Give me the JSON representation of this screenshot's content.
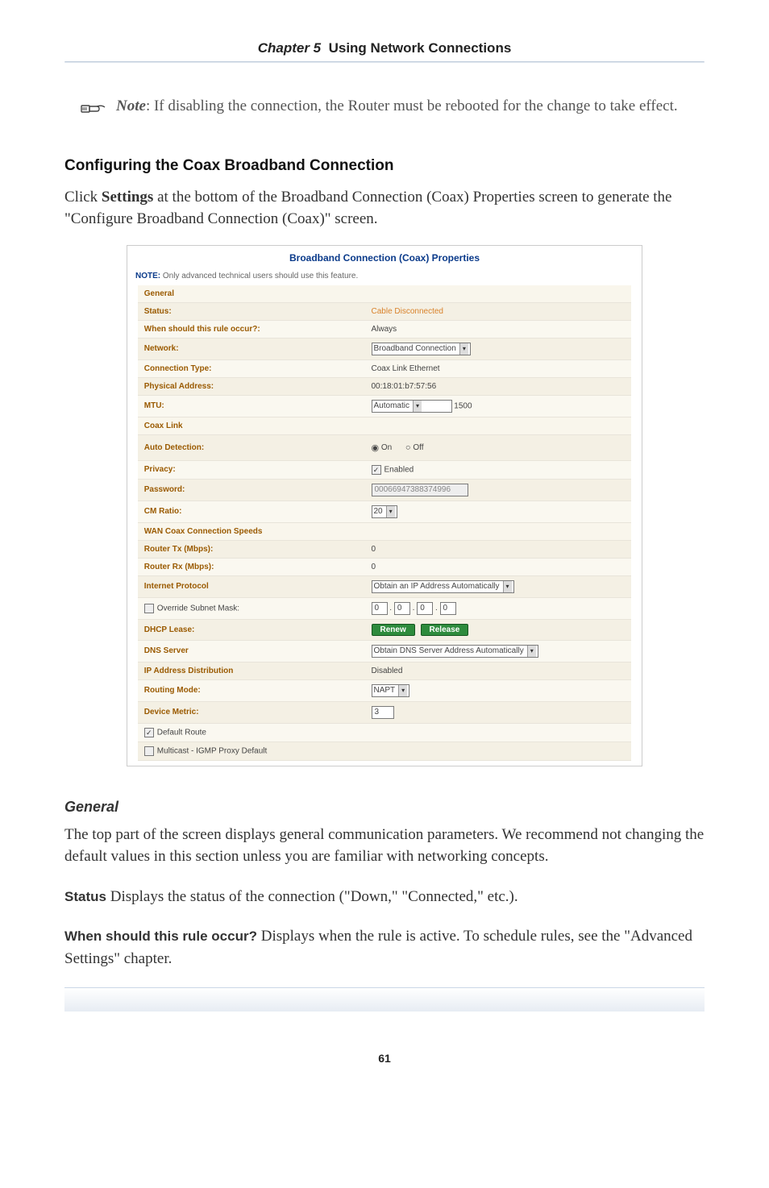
{
  "header": {
    "chapter_label": "Chapter 5",
    "chapter_title": "Using Network Connections"
  },
  "note": {
    "prefix": "Note",
    "text": ": If disabling the connection, the Router must be rebooted for the change to take effect."
  },
  "section1": {
    "heading": "Configuring the Coax Broadband Connection",
    "para": "Click Settings at the bottom of the Broadband Connection (Coax) Properties screen to generate the \"Configure Broadband Connection (Coax)\" screen.",
    "para_pre": "Click ",
    "para_bold": "Settings",
    "para_post": " at the bottom of the Broadband Connection (Coax) Properties screen to generate the \"Configure Broadband Connection (Coax)\" screen."
  },
  "screenshot": {
    "title": "Broadband Connection (Coax) Properties",
    "note_prefix": "NOTE:",
    "note_text": " Only advanced technical users should use this feature.",
    "sections": {
      "general": "General",
      "coax_link": "Coax Link",
      "wan_speeds": "WAN Coax Connection Speeds"
    },
    "rows": {
      "status_label": "Status:",
      "status_value": "Cable Disconnected",
      "rule_label": "When should this rule occur?:",
      "rule_value": "Always",
      "network_label": "Network:",
      "network_value": "Broadband Connection",
      "conn_type_label": "Connection Type:",
      "conn_type_value": "Coax Link Ethernet",
      "phys_addr_label": "Physical Address:",
      "phys_addr_value": "00:18:01:b7:57:56",
      "mtu_label": "MTU:",
      "mtu_select": "Automatic",
      "mtu_num": "1500",
      "auto_detect_label": "Auto Detection:",
      "auto_on": "On",
      "auto_off": "Off",
      "privacy_label": "Privacy:",
      "privacy_value": "Enabled",
      "password_label": "Password:",
      "password_value": "00066947388374996",
      "cm_ratio_label": "CM Ratio:",
      "cm_ratio_value": "20",
      "router_tx_label": "Router Tx (Mbps):",
      "router_tx_value": "0",
      "router_rx_label": "Router Rx (Mbps):",
      "router_rx_value": "0",
      "internet_proto_label": "Internet Protocol",
      "internet_proto_value": "Obtain an IP Address Automatically",
      "override_mask_label": "Override Subnet Mask:",
      "mask_o1": "0",
      "mask_o2": "0",
      "mask_o3": "0",
      "mask_o4": "0",
      "dhcp_lease_label": "DHCP Lease:",
      "btn_renew": "Renew",
      "btn_release": "Release",
      "dns_server_label": "DNS Server",
      "dns_server_value": "Obtain DNS Server Address Automatically",
      "ip_dist_label": "IP Address Distribution",
      "ip_dist_value": "Disabled",
      "routing_mode_label": "Routing Mode:",
      "routing_mode_value": "NAPT",
      "device_metric_label": "Device Metric:",
      "device_metric_value": "3",
      "default_route_label": "Default Route",
      "multicast_label": "Multicast - IGMP Proxy Default"
    }
  },
  "general_section": {
    "heading": "General",
    "para": "The top part of the screen displays general communication parameters. We recommend not changing the default values in this section unless you are familiar with networking concepts.",
    "status_runin": "Status",
    "status_body": "  Displays the status of the connection (\"Down,\" \"Connected,\" etc.).",
    "rule_runin": "When should this rule occur?",
    "rule_body": "  Displays when the rule is active. To schedule rules, see the \"Advanced Settings\" chapter."
  },
  "page_number": "61"
}
